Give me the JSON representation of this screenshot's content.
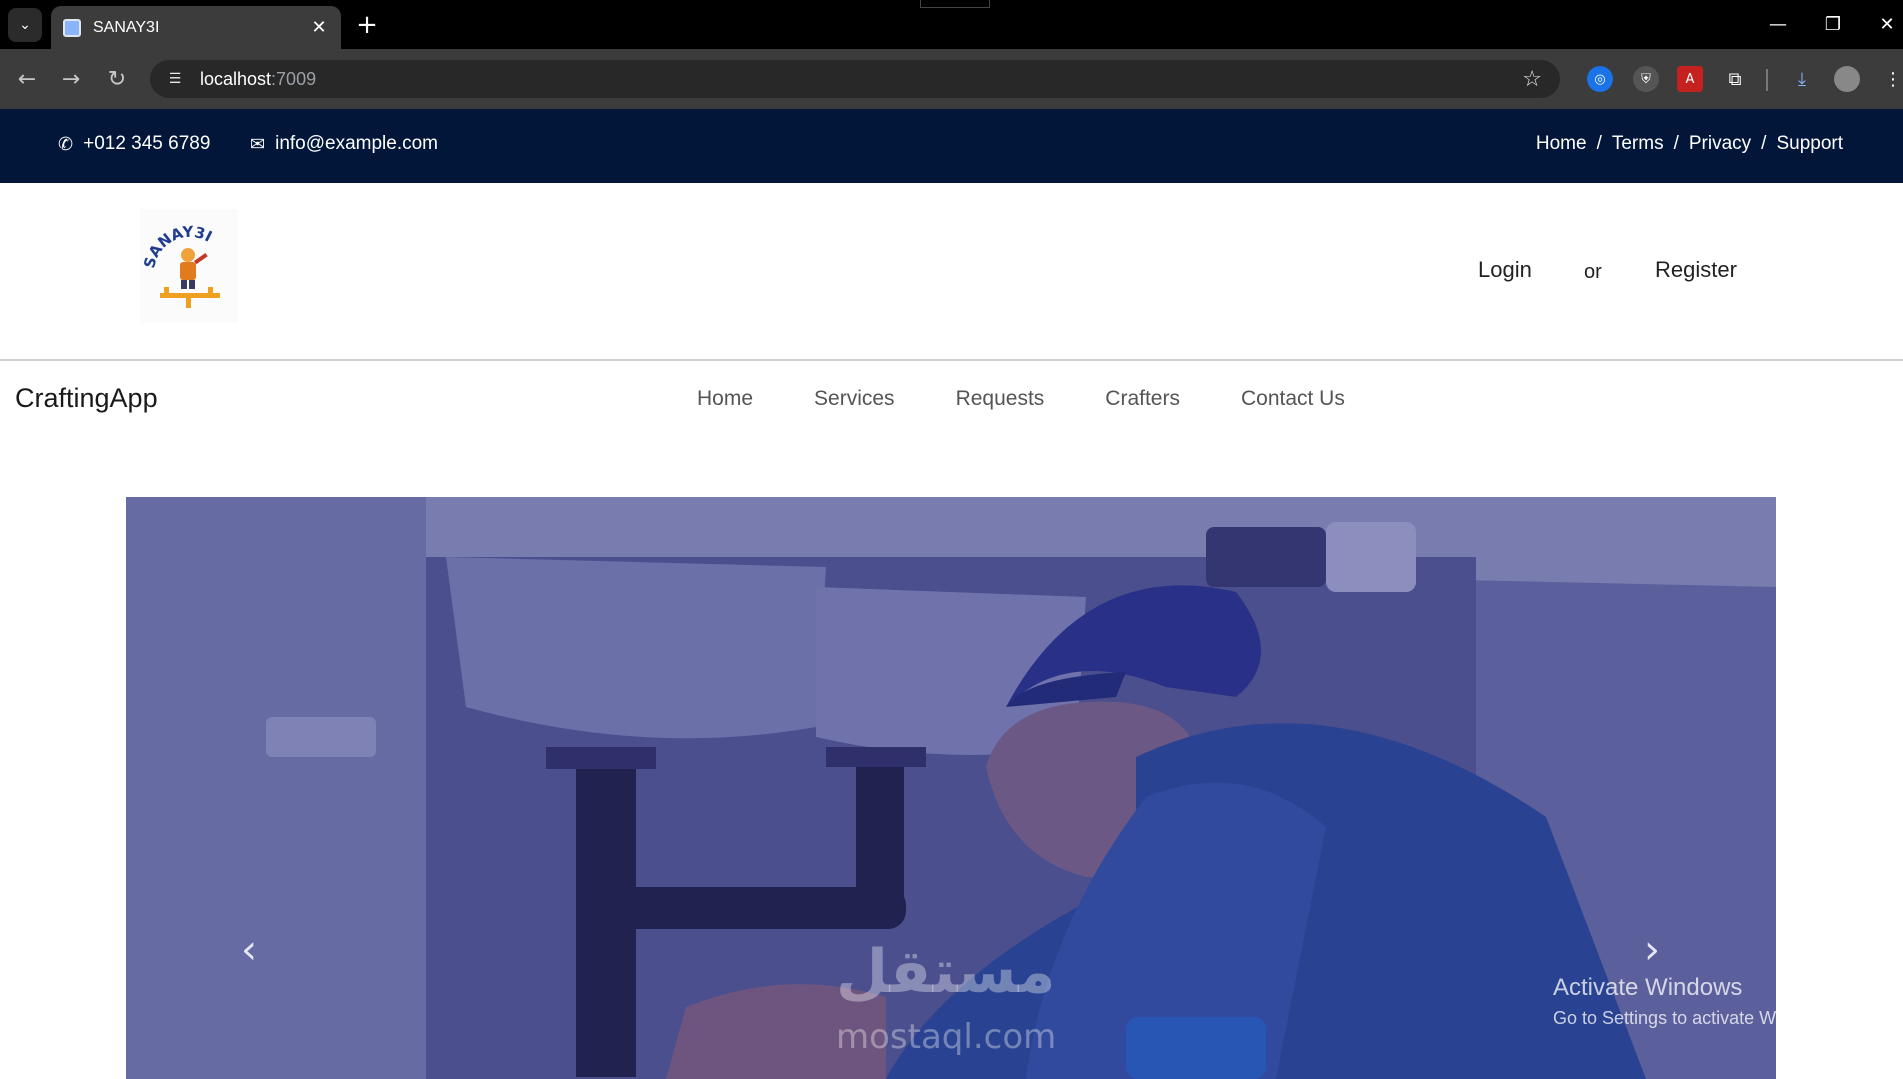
{
  "browser": {
    "tab_title": "SANAY3I",
    "url_host": "localhost",
    "url_port": ":7009"
  },
  "topbar": {
    "phone": "+012 345 6789",
    "email": "info@example.com",
    "links": [
      "Home",
      "Terms",
      "Privacy",
      "Support"
    ],
    "separator": "/"
  },
  "header": {
    "logo_text": "SANAY3I",
    "login": "Login",
    "or": "or",
    "register": "Register"
  },
  "nav": {
    "brand": "CraftingApp",
    "items": [
      "Home",
      "Services",
      "Requests",
      "Crafters",
      "Contact Us"
    ]
  },
  "hero": {
    "prev": "‹",
    "next": "›",
    "watermark_ar": "مستقل",
    "watermark_en": "mostaql.com"
  },
  "os_overlay": {
    "title": "Activate Windows",
    "subtitle": "Go to Settings to activate Windows."
  },
  "colors": {
    "topbar_bg": "#011638",
    "hero_tint": "#6a6fa8"
  }
}
